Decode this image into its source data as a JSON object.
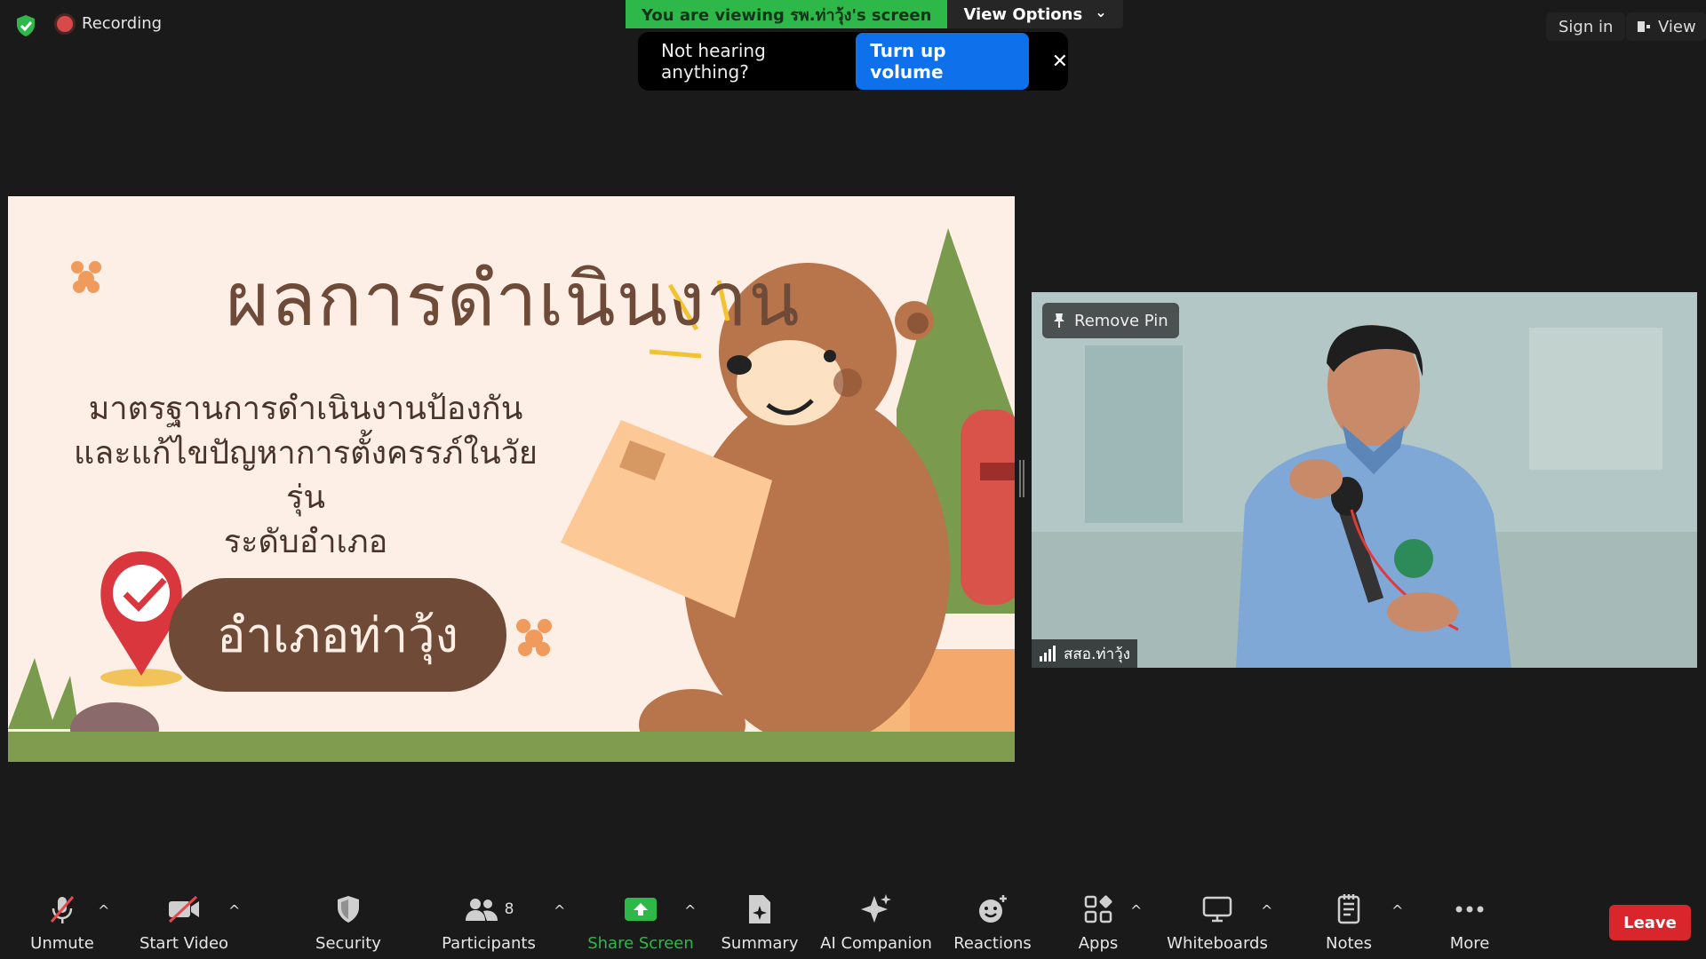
{
  "topbar": {
    "recording_label": "Recording",
    "viewing_text": "You are viewing รพ.ท่าวุ้ง's screen",
    "view_options_label": "View Options",
    "notice_text": "Not hearing anything?",
    "turn_up_label": "Turn up volume",
    "close_glyph": "✕",
    "sign_in_label": "Sign in",
    "view_label": "View",
    "dropdown_glyph": "⌄"
  },
  "slide": {
    "title": "ผลการดำเนินงาน",
    "subtitle_lines": [
      "มาตรฐานการดำเนินงานป้องกัน",
      "และแก้ไขปัญหาการตั้งครรภ์ในวัยรุ่น",
      "ระดับอำเภอ"
    ],
    "pill_label": "อำเภอท่าวุ้ง"
  },
  "video": {
    "remove_pin_label": "Remove Pin",
    "participant_name": "สสอ.ท่าวุ้ง"
  },
  "toolbar": {
    "items": [
      {
        "label": "Unmute",
        "icon": "mic-muted-icon"
      },
      {
        "label": "Start Video",
        "icon": "video-off-icon"
      },
      {
        "label": "Security",
        "icon": "shield-icon"
      },
      {
        "label": "Participants",
        "icon": "participants-icon",
        "count": "8"
      },
      {
        "label": "Share Screen",
        "icon": "share-screen-icon"
      },
      {
        "label": "Summary",
        "icon": "summary-icon"
      },
      {
        "label": "AI Companion",
        "icon": "sparkle-icon"
      },
      {
        "label": "Reactions",
        "icon": "reactions-icon"
      },
      {
        "label": "Apps",
        "icon": "apps-icon"
      },
      {
        "label": "Whiteboards",
        "icon": "whiteboard-icon"
      },
      {
        "label": "Notes",
        "icon": "notes-icon"
      },
      {
        "label": "More",
        "icon": "more-icon"
      }
    ],
    "caret_glyph": "^",
    "leave_label": "Leave"
  },
  "colors": {
    "share_accent": "#2fb84a",
    "leave": "#d9262c",
    "turn_up": "#0e71eb",
    "mute_red": "#e8474c"
  }
}
